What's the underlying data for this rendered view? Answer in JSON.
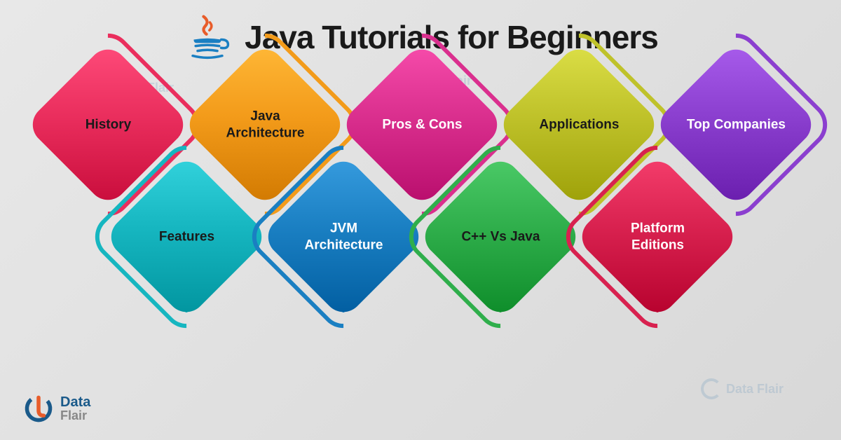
{
  "title": "Java Tutorials for Beginners",
  "brand": {
    "line1": "Data",
    "line2": "Flair",
    "watermark": "Data Flair"
  },
  "tiles": {
    "top": [
      {
        "label": "History",
        "fill": "#ea2e5d",
        "outline": "#ea2e5d",
        "dark_text": true
      },
      {
        "label": "Java Architecture",
        "fill": "#f39b1a",
        "outline": "#f39b1a",
        "dark_text": true
      },
      {
        "label": "Pros & Cons",
        "fill": "#da2f8e",
        "outline": "#da2f8e",
        "dark_text": false
      },
      {
        "label": "Applications",
        "fill": "#bfc22a",
        "outline": "#bfc22a",
        "dark_text": true
      },
      {
        "label": "Top Companies",
        "fill": "#8b3fcf",
        "outline": "#8b3fcf",
        "dark_text": false
      }
    ],
    "bottom": [
      {
        "label": "Features",
        "fill": "#16b6c0",
        "outline": "#16b6c0",
        "dark_text": true
      },
      {
        "label": "JVM Architecture",
        "fill": "#1a7fc2",
        "outline": "#1a7fc2",
        "dark_text": false
      },
      {
        "label": "C++ Vs Java",
        "fill": "#2fae4b",
        "outline": "#2fae4b",
        "dark_text": true
      },
      {
        "label": "Platform Editions",
        "fill": "#d8214f",
        "outline": "#d8214f",
        "dark_text": false
      }
    ]
  }
}
